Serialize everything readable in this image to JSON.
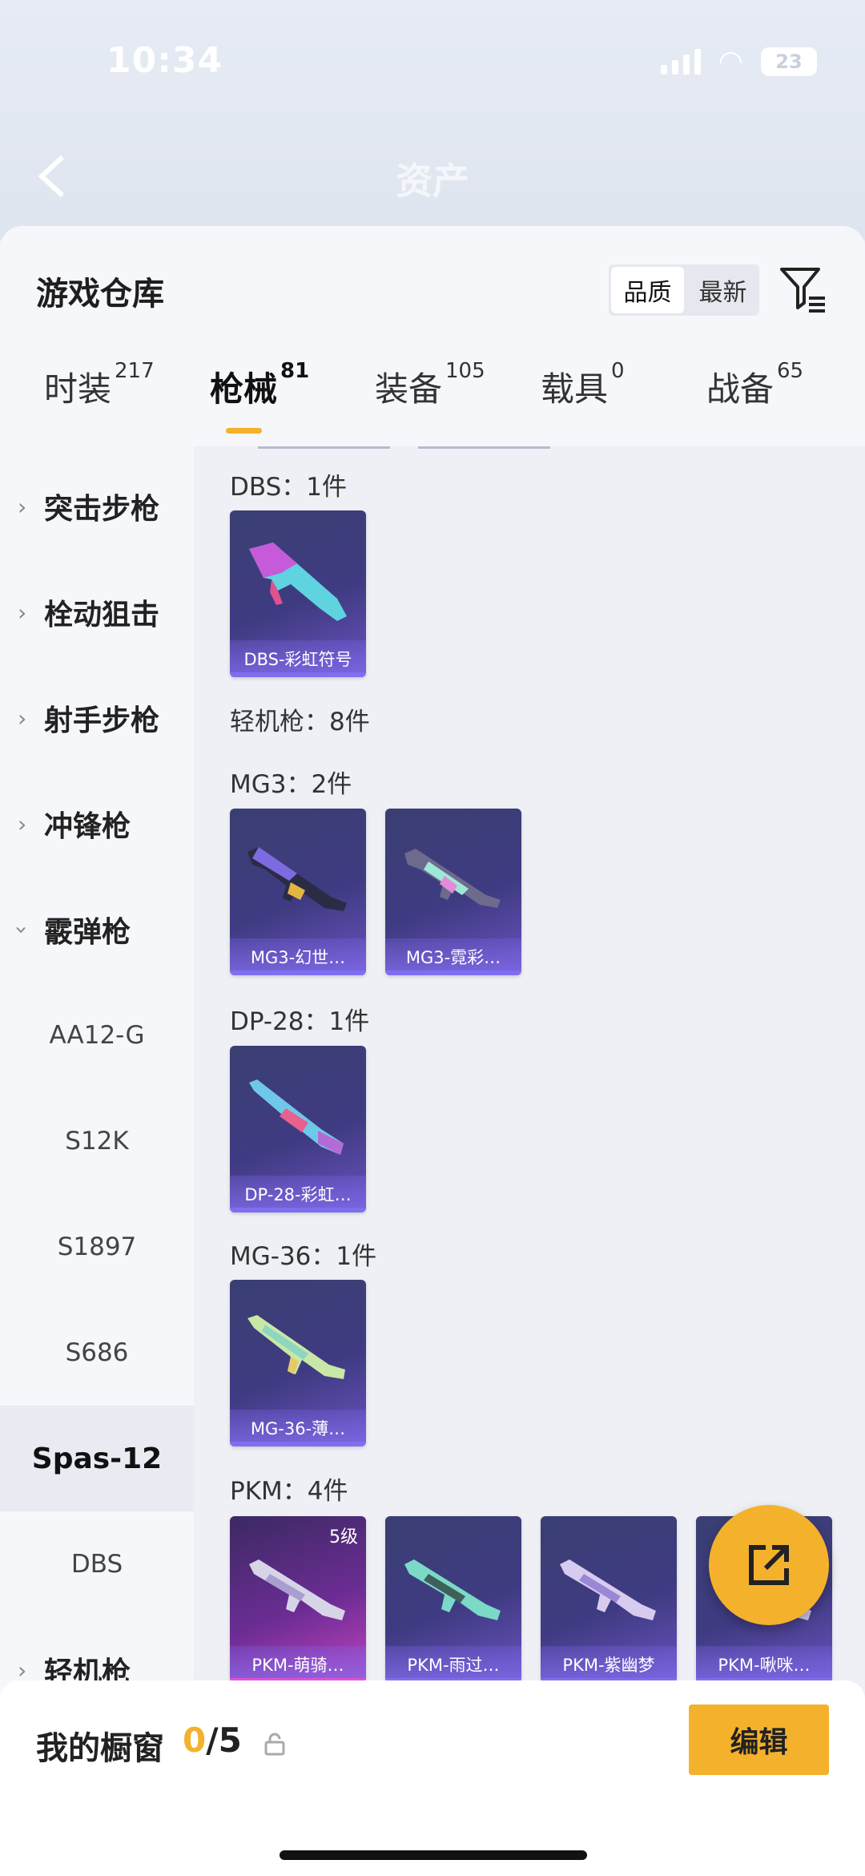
{
  "status_bar": {
    "time": "10:34",
    "battery": "23"
  },
  "header": {
    "title": "资产",
    "back_icon": "chevron-left-icon"
  },
  "sheet": {
    "title": "游戏仓库",
    "sort": {
      "options": [
        "品质",
        "最新"
      ],
      "selected": "品质"
    },
    "filter_icon": "filter-icon"
  },
  "tabs": [
    {
      "label": "时装",
      "count": "217"
    },
    {
      "label": "枪械",
      "count": "81",
      "active": true
    },
    {
      "label": "装备",
      "count": "105"
    },
    {
      "label": "载具",
      "count": "0"
    },
    {
      "label": "战备",
      "count": "65"
    }
  ],
  "sidebar": {
    "items": [
      {
        "label": "突击步枪",
        "type": "category",
        "expanded": false
      },
      {
        "label": "栓动狙击",
        "type": "category",
        "expanded": false
      },
      {
        "label": "射手步枪",
        "type": "category",
        "expanded": false
      },
      {
        "label": "冲锋枪",
        "type": "category",
        "expanded": false
      },
      {
        "label": "霰弹枪",
        "type": "category",
        "expanded": true
      },
      {
        "label": "AA12-G",
        "type": "sub"
      },
      {
        "label": "S12K",
        "type": "sub"
      },
      {
        "label": "S1897",
        "type": "sub"
      },
      {
        "label": "S686",
        "type": "sub"
      },
      {
        "label": "Spas-12",
        "type": "sub",
        "selected": true
      },
      {
        "label": "DBS",
        "type": "sub"
      },
      {
        "label": "轻机枪",
        "type": "category",
        "expanded": false
      }
    ]
  },
  "content": {
    "groups": [
      {
        "label": "DBS：1件",
        "cards": [
          {
            "name": "DBS-彩虹符号"
          }
        ]
      },
      {
        "label": "轻机枪：8件",
        "cards": []
      },
      {
        "label": "MG3：2件",
        "cards": [
          {
            "name": "MG3-幻世…"
          },
          {
            "name": "MG3-霓彩…"
          }
        ]
      },
      {
        "label": "DP-28：1件",
        "cards": [
          {
            "name": "DP-28-彩虹…"
          }
        ]
      },
      {
        "label": "MG-36：1件",
        "cards": [
          {
            "name": "MG-36-薄…"
          }
        ]
      },
      {
        "label": "PKM：4件",
        "cards": [
          {
            "name": "PKM-萌骑…",
            "level": "5级",
            "rarity": "legendary"
          },
          {
            "name": "PKM-雨过…"
          },
          {
            "name": "PKM-紫幽梦"
          },
          {
            "name": "PKM-啾咪…"
          }
        ]
      }
    ]
  },
  "fab": {
    "icon": "share-external-icon"
  },
  "bottom": {
    "label": "我的橱窗",
    "count_current": "0",
    "count_total": "/5",
    "edit_label": "编辑"
  },
  "colors": {
    "accent": "#f4b22c",
    "card_purple": "#3f3b82",
    "card_pink": "#c243c0"
  }
}
